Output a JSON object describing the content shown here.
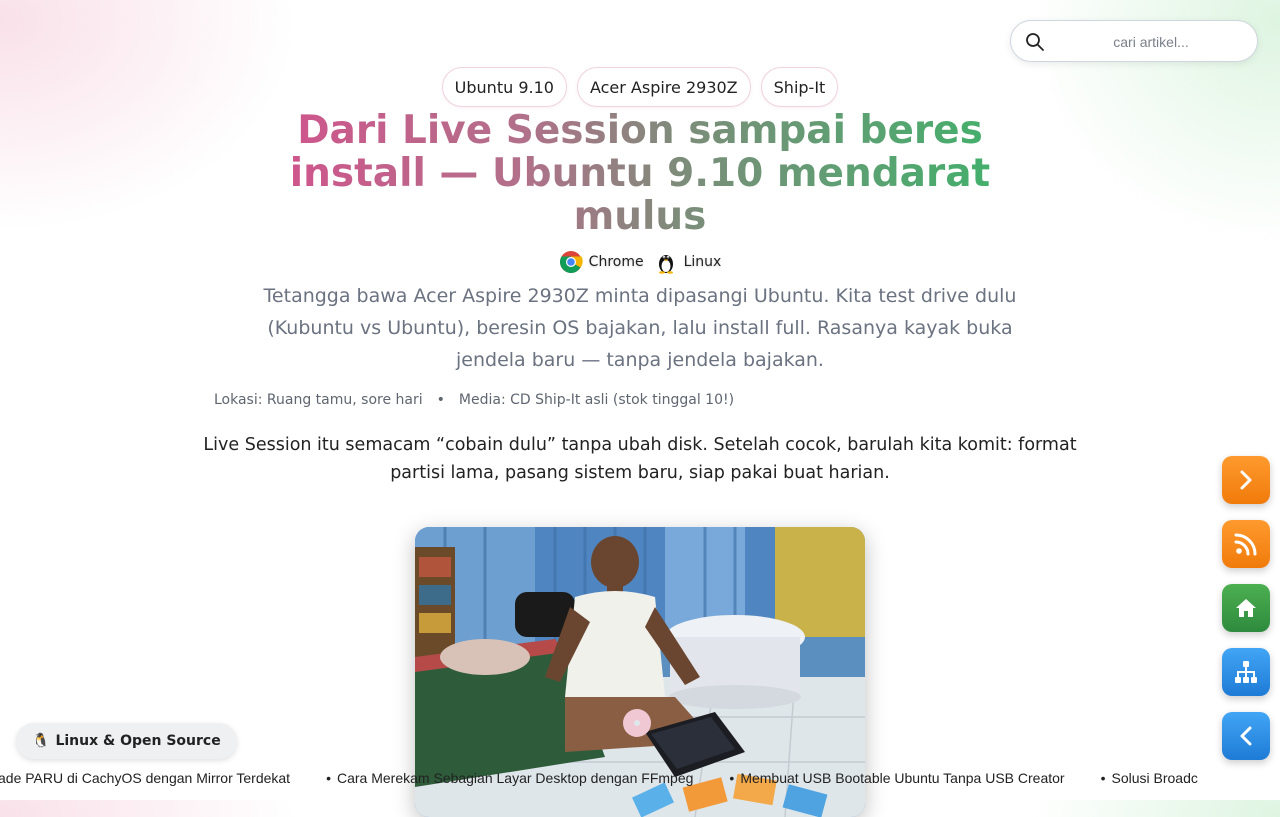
{
  "search": {
    "placeholder": "cari artikel..."
  },
  "tags": [
    "Ubuntu 9.10",
    "Acer Aspire 2930Z",
    "Ship-It"
  ],
  "article": {
    "title": "Dari Live Session sampai beres install — Ubuntu 9.10 mendarat mulus",
    "platforms": [
      {
        "label": "Chrome",
        "icon": "chrome-icon"
      },
      {
        "label": "Linux",
        "icon": "tux-icon"
      }
    ],
    "subtitle": "Tetangga bawa Acer Aspire 2930Z minta dipasangi Ubuntu. Kita test drive dulu (Kubuntu vs Ubuntu), beresin OS bajakan, lalu install full. Rasanya kayak buka jendela baru — tanpa jendela bajakan.",
    "meta": {
      "location": "Lokasi: Ruang tamu, sore hari",
      "separator": "•",
      "media": "Media: CD Ship-It asli (stok tinggal 10!)"
    },
    "lead": "Live Session itu semacam “cobain dulu” tanpa ubah disk. Setelah cocok, barulah kita komit: format partisi lama, pasang sistem baru, siap pakai buat harian."
  },
  "fabs": [
    {
      "name": "next-button",
      "icon": "chevron-right-icon",
      "color": "#f7870f"
    },
    {
      "name": "rss-button",
      "icon": "rss-icon",
      "color": "#f7870f"
    },
    {
      "name": "home-button",
      "icon": "home-icon",
      "color": "#3a9c45"
    },
    {
      "name": "sitemap-button",
      "icon": "sitemap-icon",
      "color": "#2f8fe6"
    },
    {
      "name": "back-button",
      "icon": "chevron-left-icon",
      "color": "#2f8fe6"
    }
  ],
  "category": {
    "emoji": "🐧",
    "label": "Linux & Open Source"
  },
  "ticker": [
    "ade PARU di CachyOS dengan Mirror Terdekat",
    "Cara Merekam Sebagian Layar Desktop dengan FFmpeg",
    "Membuat USB Bootable Ubuntu Tanpa USB Creator",
    "Solusi Broadc"
  ]
}
